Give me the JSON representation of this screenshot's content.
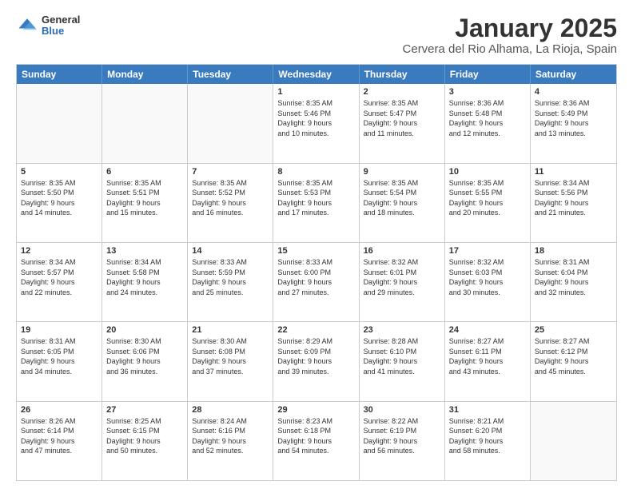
{
  "logo": {
    "general": "General",
    "blue": "Blue"
  },
  "header": {
    "title": "January 2025",
    "subtitle": "Cervera del Rio Alhama, La Rioja, Spain"
  },
  "weekdays": [
    "Sunday",
    "Monday",
    "Tuesday",
    "Wednesday",
    "Thursday",
    "Friday",
    "Saturday"
  ],
  "rows": [
    [
      {
        "day": "",
        "info": ""
      },
      {
        "day": "",
        "info": ""
      },
      {
        "day": "",
        "info": ""
      },
      {
        "day": "1",
        "info": "Sunrise: 8:35 AM\nSunset: 5:46 PM\nDaylight: 9 hours\nand 10 minutes."
      },
      {
        "day": "2",
        "info": "Sunrise: 8:35 AM\nSunset: 5:47 PM\nDaylight: 9 hours\nand 11 minutes."
      },
      {
        "day": "3",
        "info": "Sunrise: 8:36 AM\nSunset: 5:48 PM\nDaylight: 9 hours\nand 12 minutes."
      },
      {
        "day": "4",
        "info": "Sunrise: 8:36 AM\nSunset: 5:49 PM\nDaylight: 9 hours\nand 13 minutes."
      }
    ],
    [
      {
        "day": "5",
        "info": "Sunrise: 8:35 AM\nSunset: 5:50 PM\nDaylight: 9 hours\nand 14 minutes."
      },
      {
        "day": "6",
        "info": "Sunrise: 8:35 AM\nSunset: 5:51 PM\nDaylight: 9 hours\nand 15 minutes."
      },
      {
        "day": "7",
        "info": "Sunrise: 8:35 AM\nSunset: 5:52 PM\nDaylight: 9 hours\nand 16 minutes."
      },
      {
        "day": "8",
        "info": "Sunrise: 8:35 AM\nSunset: 5:53 PM\nDaylight: 9 hours\nand 17 minutes."
      },
      {
        "day": "9",
        "info": "Sunrise: 8:35 AM\nSunset: 5:54 PM\nDaylight: 9 hours\nand 18 minutes."
      },
      {
        "day": "10",
        "info": "Sunrise: 8:35 AM\nSunset: 5:55 PM\nDaylight: 9 hours\nand 20 minutes."
      },
      {
        "day": "11",
        "info": "Sunrise: 8:34 AM\nSunset: 5:56 PM\nDaylight: 9 hours\nand 21 minutes."
      }
    ],
    [
      {
        "day": "12",
        "info": "Sunrise: 8:34 AM\nSunset: 5:57 PM\nDaylight: 9 hours\nand 22 minutes."
      },
      {
        "day": "13",
        "info": "Sunrise: 8:34 AM\nSunset: 5:58 PM\nDaylight: 9 hours\nand 24 minutes."
      },
      {
        "day": "14",
        "info": "Sunrise: 8:33 AM\nSunset: 5:59 PM\nDaylight: 9 hours\nand 25 minutes."
      },
      {
        "day": "15",
        "info": "Sunrise: 8:33 AM\nSunset: 6:00 PM\nDaylight: 9 hours\nand 27 minutes."
      },
      {
        "day": "16",
        "info": "Sunrise: 8:32 AM\nSunset: 6:01 PM\nDaylight: 9 hours\nand 29 minutes."
      },
      {
        "day": "17",
        "info": "Sunrise: 8:32 AM\nSunset: 6:03 PM\nDaylight: 9 hours\nand 30 minutes."
      },
      {
        "day": "18",
        "info": "Sunrise: 8:31 AM\nSunset: 6:04 PM\nDaylight: 9 hours\nand 32 minutes."
      }
    ],
    [
      {
        "day": "19",
        "info": "Sunrise: 8:31 AM\nSunset: 6:05 PM\nDaylight: 9 hours\nand 34 minutes."
      },
      {
        "day": "20",
        "info": "Sunrise: 8:30 AM\nSunset: 6:06 PM\nDaylight: 9 hours\nand 36 minutes."
      },
      {
        "day": "21",
        "info": "Sunrise: 8:30 AM\nSunset: 6:08 PM\nDaylight: 9 hours\nand 37 minutes."
      },
      {
        "day": "22",
        "info": "Sunrise: 8:29 AM\nSunset: 6:09 PM\nDaylight: 9 hours\nand 39 minutes."
      },
      {
        "day": "23",
        "info": "Sunrise: 8:28 AM\nSunset: 6:10 PM\nDaylight: 9 hours\nand 41 minutes."
      },
      {
        "day": "24",
        "info": "Sunrise: 8:27 AM\nSunset: 6:11 PM\nDaylight: 9 hours\nand 43 minutes."
      },
      {
        "day": "25",
        "info": "Sunrise: 8:27 AM\nSunset: 6:12 PM\nDaylight: 9 hours\nand 45 minutes."
      }
    ],
    [
      {
        "day": "26",
        "info": "Sunrise: 8:26 AM\nSunset: 6:14 PM\nDaylight: 9 hours\nand 47 minutes."
      },
      {
        "day": "27",
        "info": "Sunrise: 8:25 AM\nSunset: 6:15 PM\nDaylight: 9 hours\nand 50 minutes."
      },
      {
        "day": "28",
        "info": "Sunrise: 8:24 AM\nSunset: 6:16 PM\nDaylight: 9 hours\nand 52 minutes."
      },
      {
        "day": "29",
        "info": "Sunrise: 8:23 AM\nSunset: 6:18 PM\nDaylight: 9 hours\nand 54 minutes."
      },
      {
        "day": "30",
        "info": "Sunrise: 8:22 AM\nSunset: 6:19 PM\nDaylight: 9 hours\nand 56 minutes."
      },
      {
        "day": "31",
        "info": "Sunrise: 8:21 AM\nSunset: 6:20 PM\nDaylight: 9 hours\nand 58 minutes."
      },
      {
        "day": "",
        "info": ""
      }
    ]
  ]
}
